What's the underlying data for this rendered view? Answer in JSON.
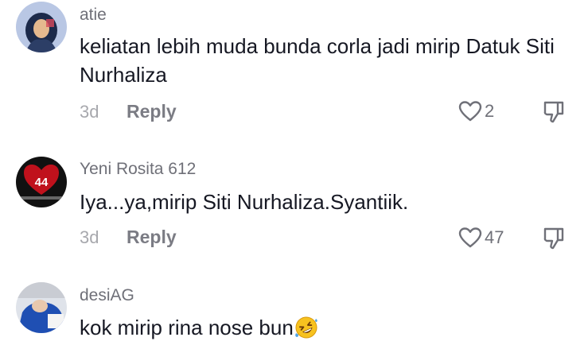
{
  "comments": [
    {
      "username": "atie",
      "text": "keliatan lebih muda bunda corla jadi mirip Datuk Siti Nurhaliza",
      "time": "3d",
      "reply_label": "Reply",
      "likes": "2"
    },
    {
      "username": "Yeni Rosita 612",
      "avatar_badge": "44",
      "text": "Iya...ya,mirip Siti Nurhaliza.Syantiik.",
      "time": "3d",
      "reply_label": "Reply",
      "likes": "47"
    },
    {
      "username": "desiAG",
      "text": "kok mirip rina nose bun",
      "emoji": "rolling-on-floor-laughing"
    }
  ],
  "colors": {
    "text_primary": "#161823",
    "text_secondary": "#6f7078",
    "text_muted": "#a7a8ad"
  },
  "icons": {
    "like": "heart-outline-icon",
    "dislike": "thumbs-down-outline-icon"
  }
}
